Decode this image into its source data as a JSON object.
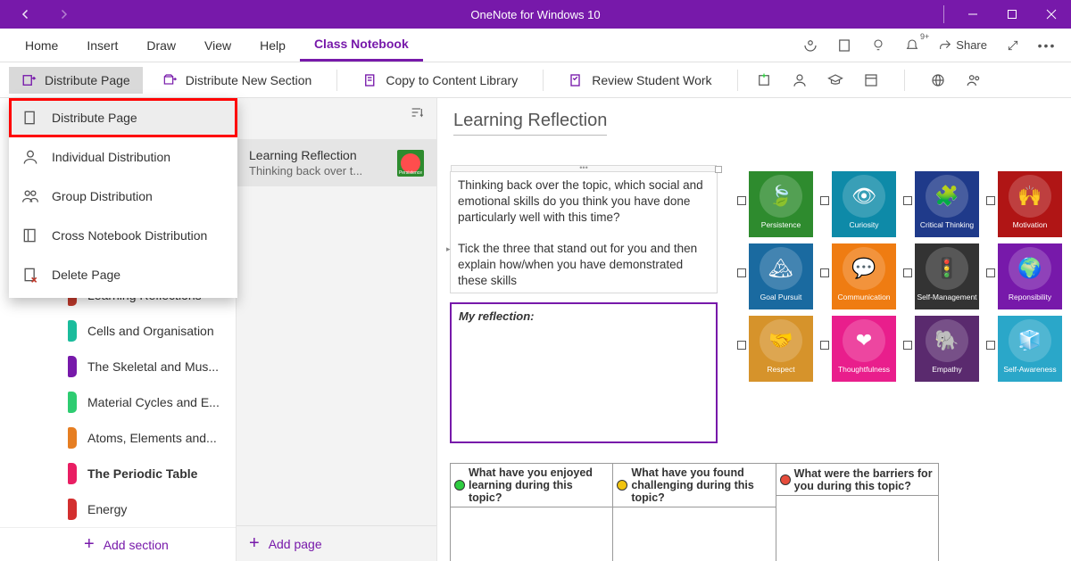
{
  "titlebar": {
    "title": "OneNote for Windows 10"
  },
  "ribbon": {
    "tabs": [
      "Home",
      "Insert",
      "Draw",
      "View",
      "Help",
      "Class Notebook"
    ],
    "active_index": 5,
    "share_label": "Share",
    "bell_count": "9+"
  },
  "commands": {
    "distribute_page": "Distribute Page",
    "distribute_new_section": "Distribute New Section",
    "copy_library": "Copy to Content Library",
    "review_work": "Review Student Work"
  },
  "context_menu": {
    "items": [
      "Distribute Page",
      "Individual Distribution",
      "Group Distribution",
      "Cross Notebook Distribution",
      "Delete Page"
    ]
  },
  "sections": {
    "items": [
      {
        "label": "Learning Reflections",
        "color": "#c0392b"
      },
      {
        "label": "Cells and Organisation",
        "color": "#1abc9c"
      },
      {
        "label": "The Skeletal and Mus...",
        "color": "#7719AA"
      },
      {
        "label": "Material Cycles and E...",
        "color": "#2ecc71"
      },
      {
        "label": "Atoms, Elements and...",
        "color": "#e67e22"
      },
      {
        "label": "The Periodic Table",
        "color": "#e91e63",
        "bold": true
      },
      {
        "label": "Energy",
        "color": "#d32f2f"
      }
    ],
    "add_label": "Add section"
  },
  "pages": {
    "item": {
      "title": "Learning Reflection",
      "subtitle": "Thinking back over t...",
      "thumb_label": "Persistence"
    },
    "add_label": "Add page"
  },
  "canvas": {
    "title": "Learning Reflection",
    "para1": "Thinking back over the topic, which social and emotional skills do you think you have done particularly well with this time?",
    "para2": "Tick the three that stand out for you and then explain how/when you have demonstrated these skills",
    "reflection_label": "My reflection:",
    "skills": [
      {
        "label": "Persistence",
        "bg": "#2e8b2e"
      },
      {
        "label": "Curiosity",
        "bg": "#0e8aa8"
      },
      {
        "label": "Critical Thinking",
        "bg": "#1f3a8a"
      },
      {
        "label": "Motivation",
        "bg": "#b01515"
      },
      {
        "label": "Goal Pursuit",
        "bg": "#1a6aa0"
      },
      {
        "label": "Communication",
        "bg": "#ef7c12"
      },
      {
        "label": "Self-Management",
        "bg": "#333333"
      },
      {
        "label": "Reponsibility",
        "bg": "#7719AA"
      },
      {
        "label": "Respect",
        "bg": "#d6932b"
      },
      {
        "label": "Thoughtfulness",
        "bg": "#e91e8c"
      },
      {
        "label": "Empathy",
        "bg": "#5a2a6e"
      },
      {
        "label": "Self-Awareness",
        "bg": "#2aa7c9"
      }
    ],
    "qcols": [
      {
        "color": "#2ecc40",
        "text": "What have you enjoyed learning during this topic?"
      },
      {
        "color": "#f1c40f",
        "text": "What have you found challenging during this topic?"
      },
      {
        "color": "#e74c3c",
        "text": "What were the barriers for you during this topic?"
      }
    ]
  }
}
